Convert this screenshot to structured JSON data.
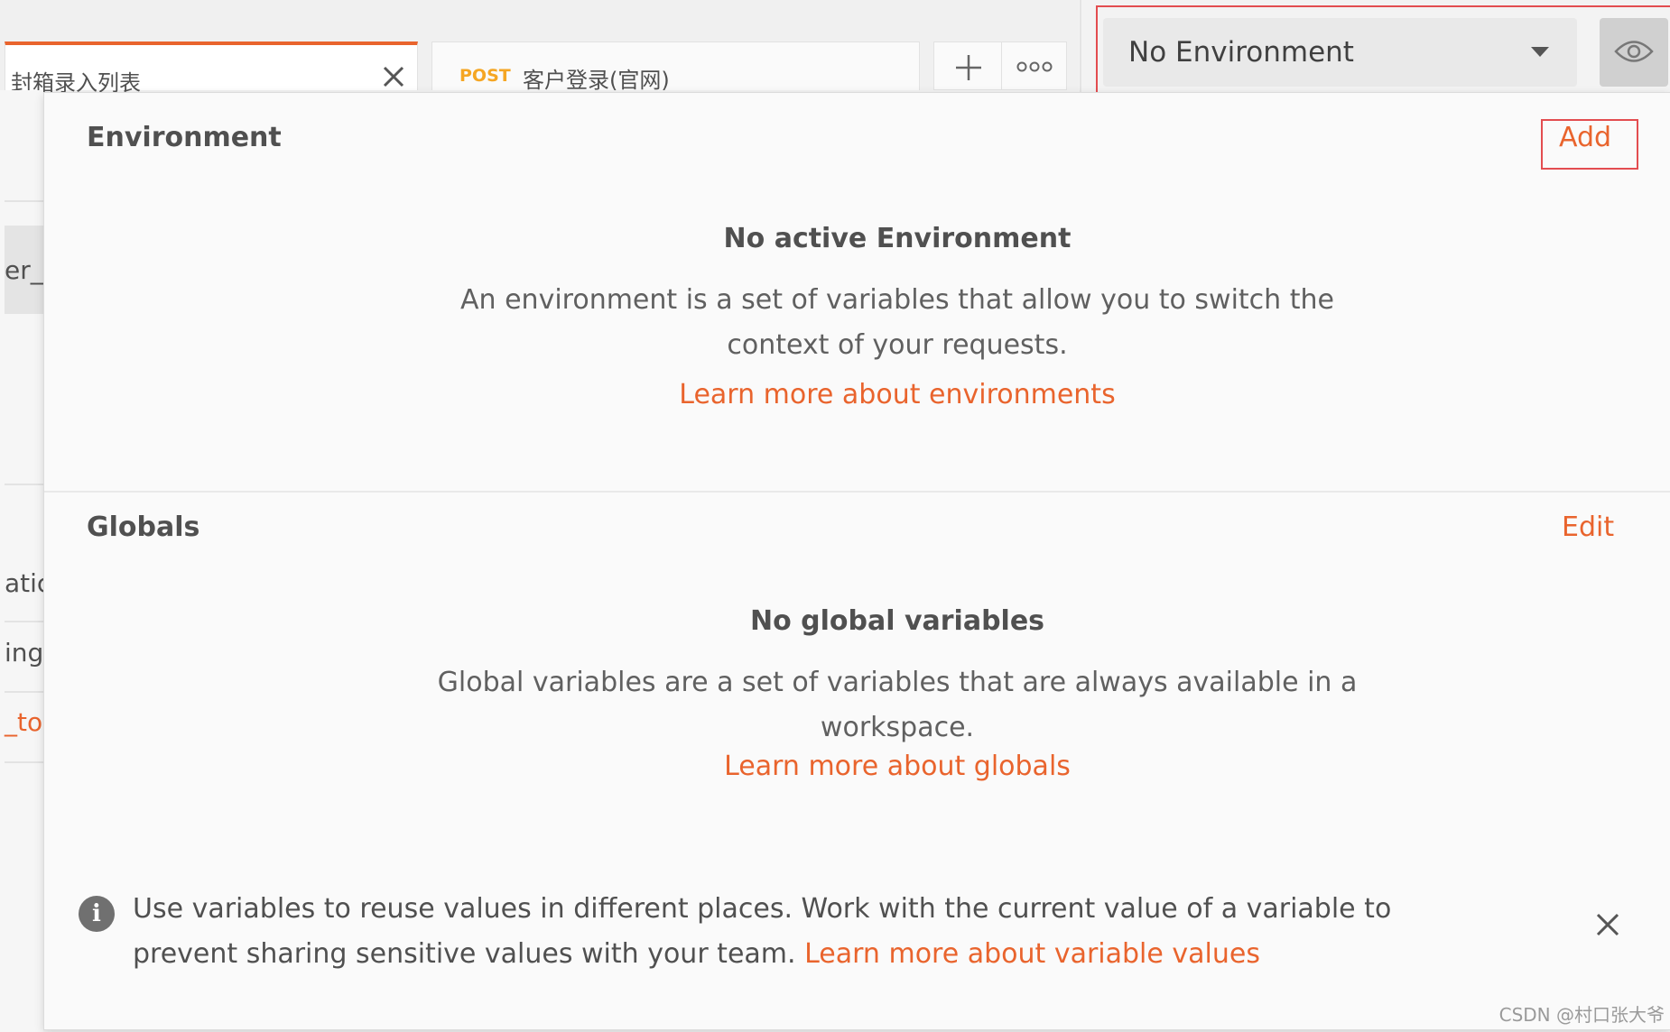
{
  "tabs": {
    "active": {
      "label": "封箱录入列表"
    },
    "post": {
      "method": "POST",
      "label": "客户登录(官网)"
    }
  },
  "environment_selector": {
    "selected": "No Environment"
  },
  "sidebar": {
    "items": [
      "er_",
      "atic",
      "ing",
      "_to"
    ]
  },
  "popover": {
    "environment": {
      "title": "Environment",
      "add_label": "Add",
      "empty_title": "No active Environment",
      "empty_desc_line1": "An environment is a set of variables that allow you to switch the",
      "empty_desc_line2": "context of your requests.",
      "learn_more": "Learn more about environments"
    },
    "globals": {
      "title": "Globals",
      "edit_label": "Edit",
      "empty_title": "No global variables",
      "empty_desc_line1": "Global variables are a set of variables that are always available in a",
      "empty_desc_line2": "workspace.",
      "learn_more": "Learn more about globals"
    },
    "info": {
      "text": "Use variables to reuse values in different places. Work with the current value of a variable to prevent sharing sensitive values with your team.",
      "link": "Learn more about variable values",
      "icon": "i"
    }
  },
  "watermark": "CSDN @村口张大爷",
  "colors": {
    "accent": "#e9642d",
    "highlight_box": "#e34d50",
    "post_method": "#f5a623"
  }
}
